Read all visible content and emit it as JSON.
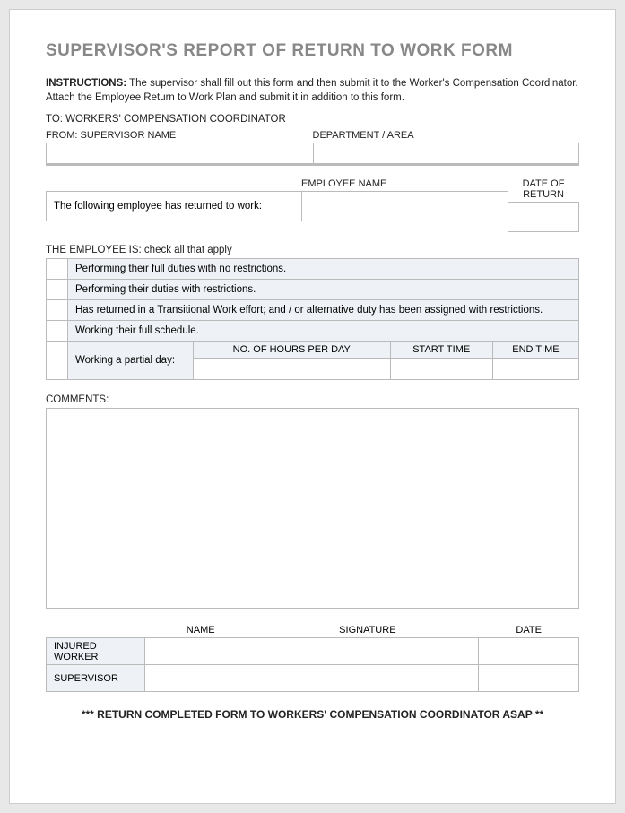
{
  "title": "SUPERVISOR'S REPORT OF RETURN TO WORK FORM",
  "instructions_label": "INSTRUCTIONS:",
  "instructions_text": " The supervisor shall fill out this form and then submit it to the Worker's Compensation Coordinator. Attach the Employee Return to Work Plan and submit it in addition to this form.",
  "to_line": "TO:  WORKERS' COMPENSATION COORDINATOR",
  "from": {
    "supervisor_label": "FROM:  SUPERVISOR NAME",
    "department_label": "DEPARTMENT / AREA"
  },
  "emp": {
    "text": "The following employee has returned to work:",
    "name_label": "EMPLOYEE NAME",
    "date_label": "DATE OF RETURN"
  },
  "check_label": "THE EMPLOYEE IS:  check all that apply",
  "options": [
    "Performing their full duties with no restrictions.",
    "Performing their duties with restrictions.",
    "Has returned in a Transitional Work effort; and / or alternative duty has been assigned with restrictions.",
    "Working their full schedule."
  ],
  "partial": {
    "label": "Working a partial day:",
    "hours": "NO. OF HOURS PER DAY",
    "start": "START TIME",
    "end": "END TIME"
  },
  "comments_label": "COMMENTS:",
  "sig": {
    "name": "NAME",
    "signature": "SIGNATURE",
    "date": "DATE",
    "injured": "INJURED WORKER",
    "supervisor": "SUPERVISOR"
  },
  "footer": "*** RETURN COMPLETED FORM TO WORKERS' COMPENSATION COORDINATOR ASAP **"
}
